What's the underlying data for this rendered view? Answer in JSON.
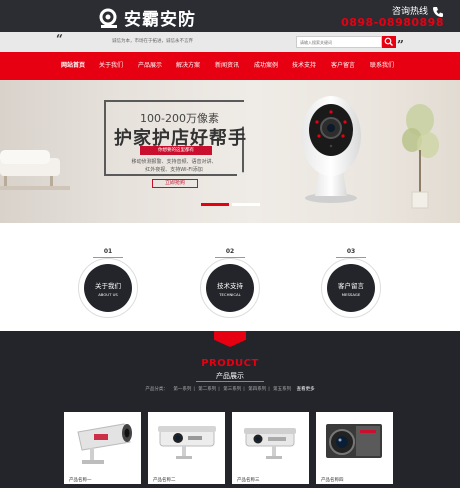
{
  "header": {
    "logo_text": "安霸安防",
    "hotline_label": "咨询热线",
    "hotline_number": "0898-08980898"
  },
  "searchbar": {
    "quote_open": "“",
    "quote_close": "”",
    "tagline": "诚信为本，市场在于拓进，诚信永不言弃",
    "placeholder": "请输入搜索关键词"
  },
  "nav": {
    "items": [
      "网站首页",
      "关于我们",
      "产品展示",
      "解决方案",
      "新闻资讯",
      "成功案例",
      "技术支持",
      "客户留言",
      "联系我们"
    ],
    "active_index": 0
  },
  "banner": {
    "pixels": "100-200万像素",
    "title": "护家护店好帮手",
    "red_tag": "你想要的这里都有",
    "desc_line1": "移动侦测报警、支持音频、语音对讲、",
    "desc_line2": "红外夜视、支持WI-FI添加",
    "button": "立即抢购",
    "slides": 3,
    "active_slide": 0
  },
  "features": [
    {
      "num": "01",
      "title": "关于我们",
      "sub": "ABOUT US"
    },
    {
      "num": "02",
      "title": "技术支持",
      "sub": "TECHNICAL"
    },
    {
      "num": "03",
      "title": "客户留言",
      "sub": "MESSAGE"
    }
  ],
  "products": {
    "title_en": "PRODUCT",
    "title_cn": "产品展示",
    "categories": [
      "产品分类：",
      "第一系列",
      "第二系列",
      "第三系列",
      "第四系列",
      "第五系列"
    ],
    "more": "查看更多",
    "items": [
      {
        "name": "产品名称一"
      },
      {
        "name": "产品名称二"
      },
      {
        "name": "产品名称三"
      },
      {
        "name": "产品名称四"
      }
    ]
  },
  "colors": {
    "brand_red": "#e60012",
    "dark": "#2b2d33"
  }
}
